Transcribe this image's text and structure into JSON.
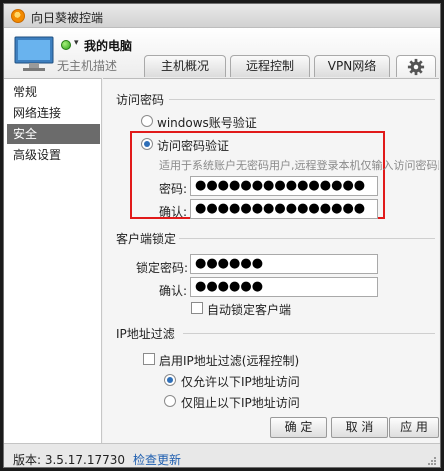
{
  "window": {
    "title": "向日葵被控端"
  },
  "header": {
    "pc_name": "我的电脑",
    "pc_desc": "无主机描述",
    "tabs": [
      {
        "label": "主机概况"
      },
      {
        "label": "远程控制"
      },
      {
        "label": "VPN网络"
      }
    ]
  },
  "sidebar": {
    "items": [
      {
        "label": "常规"
      },
      {
        "label": "网络连接"
      },
      {
        "label": "安全",
        "active": true
      },
      {
        "label": "高级设置"
      }
    ]
  },
  "access_password": {
    "section_title": "访问密码",
    "option_windows": "windows账号验证",
    "option_password": "访问密码验证",
    "selected": "access_password",
    "hint": "适用于系统账户无密码用户,远程登录本机仅输入访问密码即",
    "password_label": "密码:",
    "password_value": "●●●●●●●●●●●●●●●",
    "confirm_label": "确认:",
    "confirm_value": "●●●●●●●●●●●●●●●"
  },
  "client_lock": {
    "section_title": "客户端锁定",
    "lock_password_label": "锁定密码:",
    "lock_password_value": "●●●●●●",
    "confirm_label": "确认:",
    "confirm_value": "●●●●●●",
    "auto_lock_label": "自动锁定客户端",
    "auto_lock_checked": false
  },
  "ip_filter": {
    "section_title": "IP地址过滤",
    "enable_label": "启用IP地址过滤(远程控制)",
    "enable_checked": false,
    "allow_label": "仅允许以下IP地址访问",
    "deny_label": "仅阻止以下IP地址访问",
    "selected": "allow"
  },
  "buttons": {
    "ok": "确 定",
    "cancel": "取 消",
    "apply": "应 用"
  },
  "statusbar": {
    "version": "版本: 3.5.17.17730",
    "check_update": "检查更新"
  },
  "colors": {
    "highlight_border": "#e11a1a",
    "link": "#1f5fb0",
    "online": "#2fa21b"
  }
}
